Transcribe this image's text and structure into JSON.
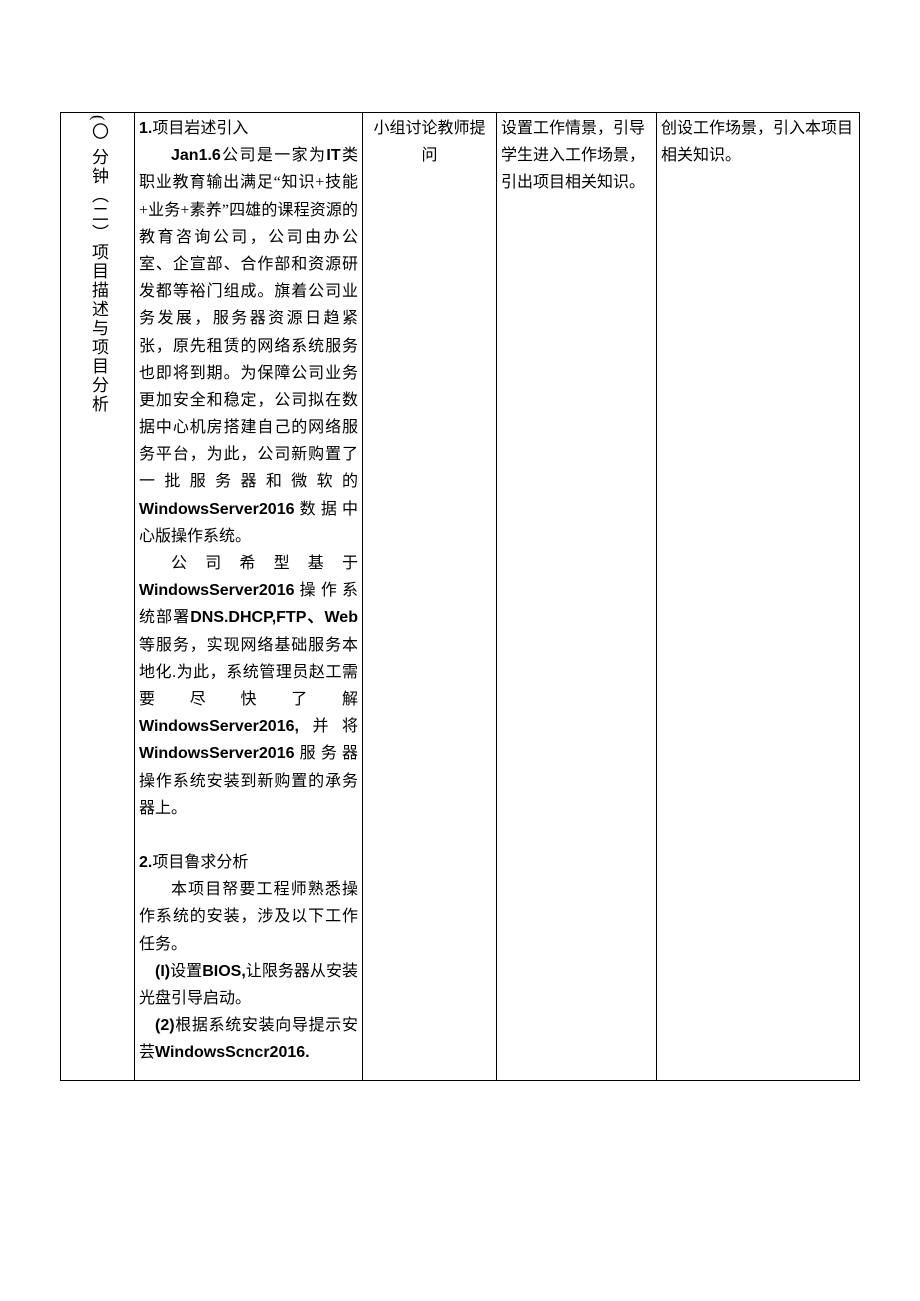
{
  "row": {
    "col0_vertical": "(〇 分钟（二）项目描述与项目分析",
    "col1": {
      "h1": "1.",
      "h1_text": "项目岩述引入",
      "p1_lead": "Jan1.6",
      "p1_rest": "公司是一家为",
      "p1_tail": "IT",
      "p1_tail2": "类职业教育输出满足“知识+技能+业务+素养”四雄的课程资源的教育咨询公司，公司由办公室、企宣部、合作部和资源研发都等裕门组成。旗着公司业务发展，服务器资源日趋紧张，原先租赁的网络系统服务也即将到期。为保障公司业务更加安全和稳定，公司拟在数据中心机房搭建自己的网络服务平台，为此，公司新购置了一批服务器和微软的",
      "p1_ws": "WindowsServer2016",
      "p1_ws_tail": "数据中心版操作系统。",
      "p2_lead": "公司希型基于",
      "p2_ws": "WindowsServer2016",
      "p2_mid": "操作系统部署",
      "p2_svc": "DNS.DHCP,FTP、Web",
      "p2_rest": "等服务，实现网络基础服务本地化.为此，系统管理员赵工需要尽快了解",
      "p2_ws2": "WindowsServer2016,",
      "p2_rest2": "并将",
      "p2_ws3": "WindowsServer2016",
      "p2_rest3": "服务器操作系统安装到新购置的承务器上。",
      "h2": "2.",
      "h2_text": "项目鲁求分析",
      "p3": "本项目帑要工程师熟悉操作系统的安装，涉及以下工作任务。",
      "li1_num": "(I)",
      "li1_a": "设置",
      "li1_b": "BIOS,",
      "li1_c": "让限务器从安装光盘引导启动。",
      "li2_num": "(2)",
      "li2_a": "根据系统安装向导提示安芸",
      "li2_b": "WindowsScncr2016."
    },
    "col2": "小组讨论教师提问",
    "col3": "设置工作情景，引导学生进入工作场景，引出项目相关知识。",
    "col4": "创设工作场景，引入本项目相关知识。"
  }
}
